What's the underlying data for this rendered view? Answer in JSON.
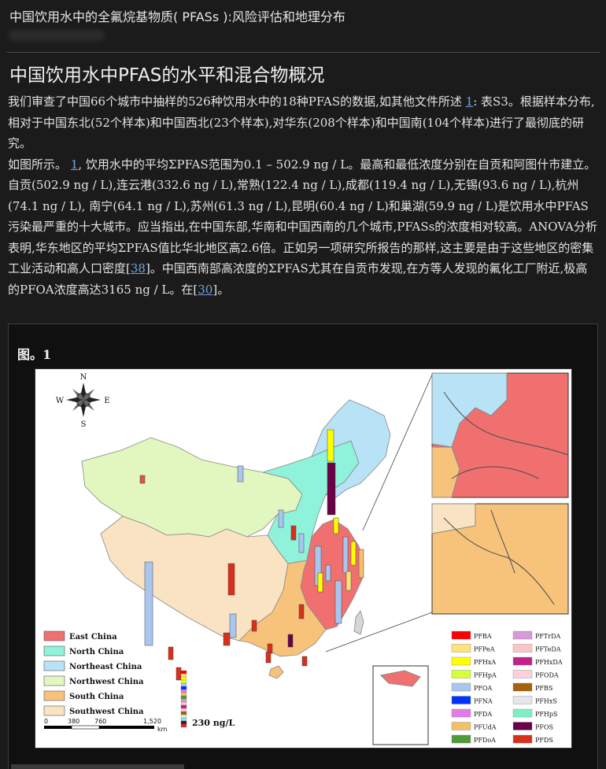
{
  "header": {
    "doc_title": "中国饮用水中的全氟烷基物质( PFASs ):风险评估和地理分布"
  },
  "section": {
    "title": "中国饮用水中PFAS的水平和混合物概况"
  },
  "paragraphs": {
    "p1_text_a": "我们审查了中国66个城市中抽样的526种饮用水中的18种PFAS的数据,如其他文件所述 ",
    "p1_link": "1",
    "p1_text_b": ": 表S3。根据样本分布,相对于中国东北(52个样本)和中国西北(23个样本),对华东(208个样本)和中国南(104个样本)进行了最彻底的研究。",
    "p2_text_a": "如图所示。 ",
    "p2_link": "1",
    "p2_text_b": ", 饮用水中的平均ΣPFAS范围为0.1 – 502.9 ng / L。最高和最低浓度分别在自贡和阿图什市建立。自贡(502.9 ng / L),连云港(332.6 ng / L),常熟(122.4 ng / L),成都(119.4 ng / L),无锡(93.6 ng / L),杭州(74.1 ng / L), 南宁(64.1 ng / L),苏州(61.3 ng / L),昆明(60.4 ng / L)和巢湖(59.9 ng / L)是饮用水中PFAS污染最严重的十大城市。应当指出,在中国东部,华南和中国西南的几个城市,PFASs的浓度相对较高。ANOVA分析表明,华东地区的平均ΣPFAS值比华北地区高2.6倍。正如另一项研究所报告的那样,这主要是由于这些地区的密集工业活动和高人口密度",
    "p2_link2": "38",
    "p2_text_c": "。中国西南部高浓度的ΣPFAS尤其在自贡市发现,在方等人发现的氟化工厂附近,极高的PFOA浓度高达3165 ng / L。在",
    "p2_link3": "30",
    "p2_text_d": "。"
  },
  "figure": {
    "label": "图。1",
    "compass": {
      "n": "N",
      "s": "S",
      "e": "E",
      "w": "W"
    },
    "regions": [
      {
        "name": "East China",
        "color": "#f07070"
      },
      {
        "name": "North China",
        "color": "#8ff2da"
      },
      {
        "name": "Northeast China",
        "color": "#b8e2f6"
      },
      {
        "name": "Northwest China",
        "color": "#e2f6c0"
      },
      {
        "name": "South China",
        "color": "#f7c37b"
      },
      {
        "name": "Southwest China",
        "color": "#fae3c2"
      }
    ],
    "scalebar": {
      "t0": "0",
      "t1": "380",
      "t2": "760",
      "t3": "1,520",
      "unit": "km"
    },
    "bar_ref": "230 ng/L",
    "compounds_left": [
      {
        "name": "PFBA",
        "color": "#ff0000"
      },
      {
        "name": "PFPeA",
        "color": "#ffe27a"
      },
      {
        "name": "PFHxA",
        "color": "#ffff00"
      },
      {
        "name": "PFHpA",
        "color": "#d4ff3a"
      },
      {
        "name": "PFOA",
        "color": "#a9c6ee"
      },
      {
        "name": "PFNA",
        "color": "#0033ff"
      },
      {
        "name": "PFDA",
        "color": "#e47ae6"
      },
      {
        "name": "PFUdA",
        "color": "#f3c06a"
      },
      {
        "name": "PFDoA",
        "color": "#4f9a3a"
      }
    ],
    "compounds_right": [
      {
        "name": "PFTrDA",
        "color": "#d79ad7"
      },
      {
        "name": "PFTeDA",
        "color": "#f9c6c6"
      },
      {
        "name": "PFHxDA",
        "color": "#c4208c"
      },
      {
        "name": "PFODA",
        "color": "#ffd0dc"
      },
      {
        "name": "PFBS",
        "color": "#a8600a"
      },
      {
        "name": "PFHxS",
        "color": "#e6e6e6"
      },
      {
        "name": "PFHpS",
        "color": "#7fefc4"
      },
      {
        "name": "PFOS",
        "color": "#6a0046"
      },
      {
        "name": "PFDS",
        "color": "#d8301a"
      }
    ],
    "outline_color": "#7a7a7a"
  }
}
